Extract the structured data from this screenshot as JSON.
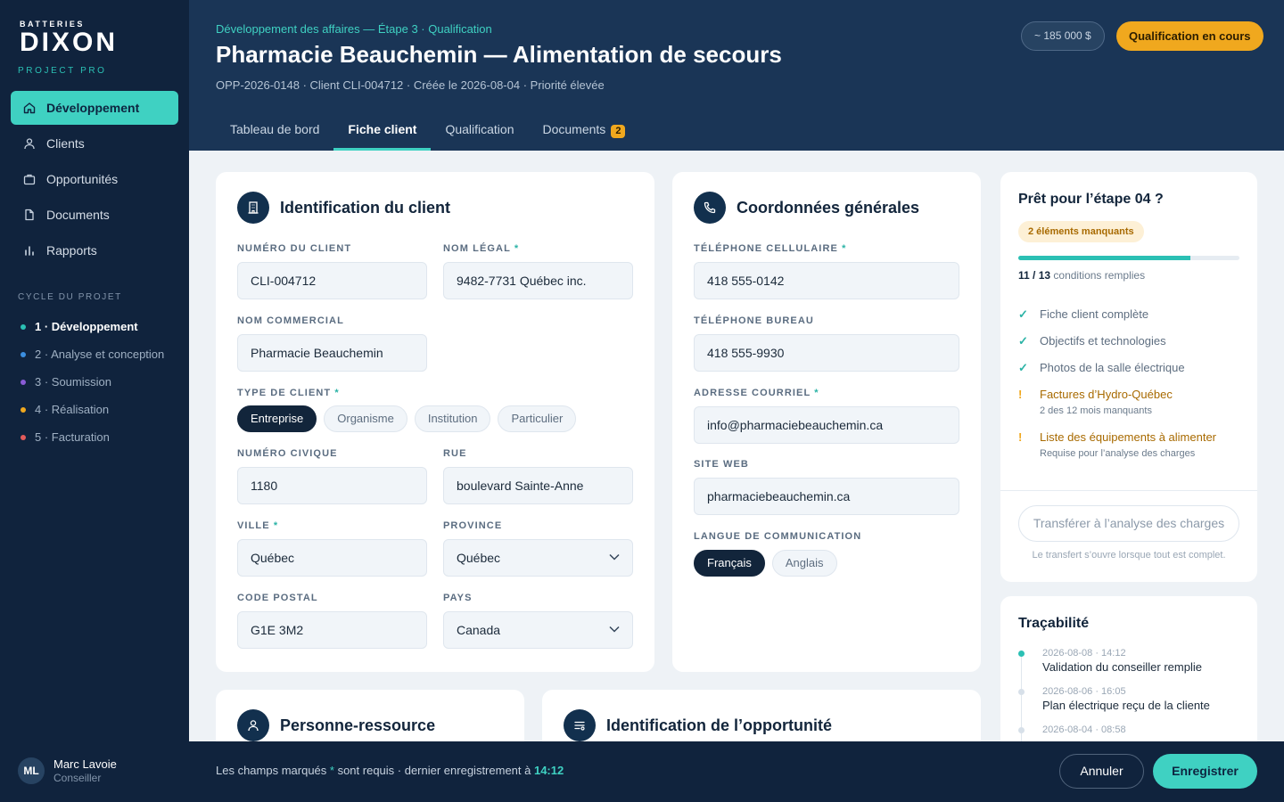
{
  "brand": {
    "top": "BATTERIES",
    "main": "DIXON",
    "sub": "PROJECT PRO"
  },
  "nav": [
    {
      "label": "Développement",
      "icon": "home-icon"
    },
    {
      "label": "Clients",
      "icon": "user-icon"
    },
    {
      "label": "Opportunités",
      "icon": "briefcase-icon"
    },
    {
      "label": "Documents",
      "icon": "document-icon"
    },
    {
      "label": "Rapports",
      "icon": "bar-chart-icon"
    }
  ],
  "cycle": {
    "title": "CYCLE DU PROJET",
    "items": [
      {
        "label": "1 · Développement",
        "color": "#2bc0b4"
      },
      {
        "label": "2 · Analyse et conception",
        "color": "#3b8ee0"
      },
      {
        "label": "3 · Soumission",
        "color": "#8a5cd6"
      },
      {
        "label": "4 · Réalisation",
        "color": "#f0a81e"
      },
      {
        "label": "5 · Facturation",
        "color": "#e35b5b"
      }
    ]
  },
  "header": {
    "breadcrumb": "Développement des affaires — Étape 3 · Qualification",
    "title": "Pharmacie Beauchemin — Alimentation de secours",
    "meta": "OPP-2026-0148 · Client CLI-004712 · Créée le 2026-08-04 · Priorité élevée",
    "amount": "~ 185 000 $",
    "status": "Qualification en cours"
  },
  "tabs": [
    {
      "label": "Tableau de bord"
    },
    {
      "label": "Fiche client"
    },
    {
      "label": "Qualification"
    },
    {
      "label": "Documents",
      "badge": "2"
    }
  ],
  "client": {
    "title": "Identification du client",
    "num_label": "NUMÉRO DU CLIENT",
    "num_value": "CLI-004712",
    "legal_label": "NOM LÉGAL",
    "legal_value": "9482-7731 Québec inc.",
    "commercial_label": "NOM COMMERCIAL",
    "commercial_value": "Pharmacie Beauchemin",
    "type_label": "TYPE DE CLIENT",
    "types": [
      "Entreprise",
      "Organisme",
      "Institution",
      "Particulier"
    ],
    "civic_label": "NUMÉRO CIVIQUE",
    "civic_value": "1180",
    "street_label": "RUE",
    "street_value": "boulevard Sainte-Anne",
    "city_label": "VILLE",
    "city_value": "Québec",
    "province_label": "PROVINCE",
    "province_value": "Québec",
    "postal_label": "CODE POSTAL",
    "postal_value": "G1E 3M2",
    "country_label": "PAYS",
    "country_value": "Canada"
  },
  "contact": {
    "title": "Coordonnées générales",
    "cell_label": "TÉLÉPHONE CELLULAIRE",
    "cell_value": "418 555-0142",
    "office_label": "TÉLÉPHONE BUREAU",
    "office_value": "418 555-9930",
    "email_label": "ADRESSE COURRIEL",
    "email_value": "info@pharmaciebeauchemin.ca",
    "web_label": "SITE WEB",
    "web_value": "pharmaciebeauchemin.ca",
    "lang_label": "LANGUE DE COMMUNICATION",
    "langs": [
      "Français",
      "Anglais"
    ]
  },
  "readiness": {
    "title": "Prêt pour l’étape 04 ?",
    "missing": "2 éléments manquants",
    "progress": 0.78,
    "count_bold": "11 / 13",
    "count_text": "conditions remplies",
    "items": [
      {
        "mark": "✓",
        "text": "Fiche client complète"
      },
      {
        "mark": "✓",
        "text": "Objectifs et technologies"
      },
      {
        "mark": "✓",
        "text": "Photos de la salle électrique"
      },
      {
        "mark": "!",
        "text": "Factures d’Hydro-Québec",
        "sub": "2 des 12 mois manquants"
      },
      {
        "mark": "!",
        "text": "Liste des équipements à alimenter",
        "sub": "Requise pour l’analyse des charges"
      }
    ],
    "transfer": "Transférer à l’analyse des charges",
    "note": "Le transfert s’ouvre lorsque tout est complet."
  },
  "trace": {
    "title": "Traçabilité",
    "events": [
      {
        "time": "2026-08-08 · 14:12",
        "text": "Validation du conseiller remplie"
      },
      {
        "time": "2026-08-06 · 16:05",
        "text": "Plan électrique reçu de la cliente"
      },
      {
        "time": "2026-08-04 · 08:58",
        "text": ""
      }
    ]
  },
  "resource": {
    "title": "Personne-ressource"
  },
  "opportunity": {
    "title": "Identification de l’opportunité"
  },
  "footer": {
    "initials": "ML",
    "name": "Marc Lavoie",
    "role": "Conseiller",
    "note_a": "Les champs marqués ",
    "note_star": "*",
    "note_b": " sont requis · dernier enregistrement à ",
    "note_time": "14:12",
    "cancel": "Annuler",
    "save": "Enregistrer"
  }
}
